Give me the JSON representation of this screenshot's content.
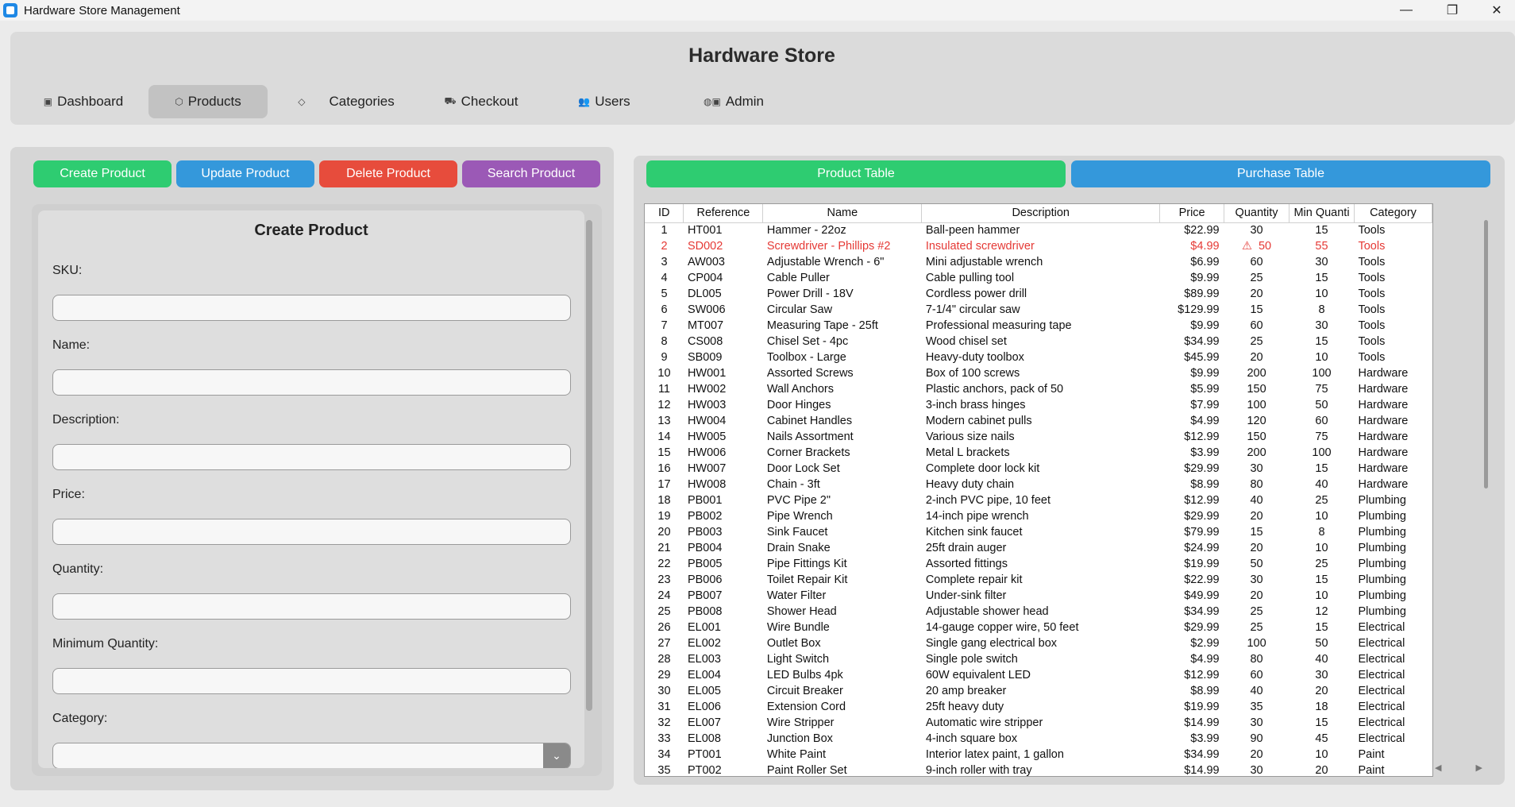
{
  "window": {
    "title": "Hardware Store Management",
    "minimize": "—",
    "maximize": "❐",
    "close": "✕"
  },
  "header": {
    "title": "Hardware Store",
    "tabs": [
      {
        "icon": "▣",
        "label": "Dashboard"
      },
      {
        "icon": "⬡",
        "label": "Products"
      },
      {
        "icon": "◇",
        "label": "Categories"
      },
      {
        "icon": "⛟",
        "label": "Checkout"
      },
      {
        "icon": "👥",
        "label": "Users"
      },
      {
        "icon": "◍▣",
        "label": "Admin"
      }
    ],
    "active_tab": "Products"
  },
  "actions": {
    "create": "Create Product",
    "update": "Update Product",
    "delete": "Delete Product",
    "search": "Search Product"
  },
  "form": {
    "title": "Create Product",
    "sku_label": "SKU:",
    "name_label": "Name:",
    "description_label": "Description:",
    "price_label": "Price:",
    "quantity_label": "Quantity:",
    "min_quantity_label": "Minimum Quantity:",
    "category_label": "Category:",
    "sku_value": "",
    "name_value": "",
    "description_value": "",
    "price_value": "",
    "quantity_value": "",
    "min_quantity_value": "",
    "category_value": "",
    "dropdown_glyph": "⌄"
  },
  "table_tabs": {
    "product": "Product Table",
    "purchase": "Purchase Table"
  },
  "colors": {
    "green": "#2ecc71",
    "blue": "#3498db",
    "red": "#e74c3c",
    "purple": "#9b59b6",
    "alert": "#e53935"
  },
  "table": {
    "columns": [
      "ID",
      "Reference",
      "Name",
      "Description",
      "Price",
      "Quantity",
      "Min Quanti",
      "Category"
    ],
    "alert_glyph": "⚠",
    "rows": [
      [
        "1",
        "HT001",
        "Hammer - 22oz",
        "Ball-peen hammer",
        "$22.99",
        "30",
        "15",
        "Tools"
      ],
      [
        "2",
        "SD002",
        "Screwdriver - Phillips #2",
        "Insulated screwdriver",
        "$4.99",
        "50",
        "55",
        "Tools"
      ],
      [
        "3",
        "AW003",
        "Adjustable Wrench - 6\"",
        "Mini adjustable wrench",
        "$6.99",
        "60",
        "30",
        "Tools"
      ],
      [
        "4",
        "CP004",
        "Cable Puller",
        "Cable pulling tool",
        "$9.99",
        "25",
        "15",
        "Tools"
      ],
      [
        "5",
        "DL005",
        "Power Drill - 18V",
        "Cordless power drill",
        "$89.99",
        "20",
        "10",
        "Tools"
      ],
      [
        "6",
        "SW006",
        "Circular Saw",
        "7-1/4\" circular saw",
        "$129.99",
        "15",
        "8",
        "Tools"
      ],
      [
        "7",
        "MT007",
        "Measuring Tape - 25ft",
        "Professional measuring tape",
        "$9.99",
        "60",
        "30",
        "Tools"
      ],
      [
        "8",
        "CS008",
        "Chisel Set - 4pc",
        "Wood chisel set",
        "$34.99",
        "25",
        "15",
        "Tools"
      ],
      [
        "9",
        "SB009",
        "Toolbox - Large",
        "Heavy-duty toolbox",
        "$45.99",
        "20",
        "10",
        "Tools"
      ],
      [
        "10",
        "HW001",
        "Assorted Screws",
        "Box of 100 screws",
        "$9.99",
        "200",
        "100",
        "Hardware"
      ],
      [
        "11",
        "HW002",
        "Wall Anchors",
        "Plastic anchors, pack of 50",
        "$5.99",
        "150",
        "75",
        "Hardware"
      ],
      [
        "12",
        "HW003",
        "Door Hinges",
        "3-inch brass hinges",
        "$7.99",
        "100",
        "50",
        "Hardware"
      ],
      [
        "13",
        "HW004",
        "Cabinet Handles",
        "Modern cabinet pulls",
        "$4.99",
        "120",
        "60",
        "Hardware"
      ],
      [
        "14",
        "HW005",
        "Nails Assortment",
        "Various size nails",
        "$12.99",
        "150",
        "75",
        "Hardware"
      ],
      [
        "15",
        "HW006",
        "Corner Brackets",
        "Metal L brackets",
        "$3.99",
        "200",
        "100",
        "Hardware"
      ],
      [
        "16",
        "HW007",
        "Door Lock Set",
        "Complete door lock kit",
        "$29.99",
        "30",
        "15",
        "Hardware"
      ],
      [
        "17",
        "HW008",
        "Chain - 3ft",
        "Heavy duty chain",
        "$8.99",
        "80",
        "40",
        "Hardware"
      ],
      [
        "18",
        "PB001",
        "PVC Pipe 2\"",
        "2-inch PVC pipe, 10 feet",
        "$12.99",
        "40",
        "25",
        "Plumbing"
      ],
      [
        "19",
        "PB002",
        "Pipe Wrench",
        "14-inch pipe wrench",
        "$29.99",
        "20",
        "10",
        "Plumbing"
      ],
      [
        "20",
        "PB003",
        "Sink Faucet",
        "Kitchen sink faucet",
        "$79.99",
        "15",
        "8",
        "Plumbing"
      ],
      [
        "21",
        "PB004",
        "Drain Snake",
        "25ft drain auger",
        "$24.99",
        "20",
        "10",
        "Plumbing"
      ],
      [
        "22",
        "PB005",
        "Pipe Fittings Kit",
        "Assorted fittings",
        "$19.99",
        "50",
        "25",
        "Plumbing"
      ],
      [
        "23",
        "PB006",
        "Toilet Repair Kit",
        "Complete repair kit",
        "$22.99",
        "30",
        "15",
        "Plumbing"
      ],
      [
        "24",
        "PB007",
        "Water Filter",
        "Under-sink filter",
        "$49.99",
        "20",
        "10",
        "Plumbing"
      ],
      [
        "25",
        "PB008",
        "Shower Head",
        "Adjustable shower head",
        "$34.99",
        "25",
        "12",
        "Plumbing"
      ],
      [
        "26",
        "EL001",
        "Wire Bundle",
        "14-gauge copper wire, 50 feet",
        "$29.99",
        "25",
        "15",
        "Electrical"
      ],
      [
        "27",
        "EL002",
        "Outlet Box",
        "Single gang electrical box",
        "$2.99",
        "100",
        "50",
        "Electrical"
      ],
      [
        "28",
        "EL003",
        "Light Switch",
        "Single pole switch",
        "$4.99",
        "80",
        "40",
        "Electrical"
      ],
      [
        "29",
        "EL004",
        "LED Bulbs 4pk",
        "60W equivalent LED",
        "$12.99",
        "60",
        "30",
        "Electrical"
      ],
      [
        "30",
        "EL005",
        "Circuit Breaker",
        "20 amp breaker",
        "$8.99",
        "40",
        "20",
        "Electrical"
      ],
      [
        "31",
        "EL006",
        "Extension Cord",
        "25ft heavy duty",
        "$19.99",
        "35",
        "18",
        "Electrical"
      ],
      [
        "32",
        "EL007",
        "Wire Stripper",
        "Automatic wire stripper",
        "$14.99",
        "30",
        "15",
        "Electrical"
      ],
      [
        "33",
        "EL008",
        "Junction Box",
        "4-inch square box",
        "$3.99",
        "90",
        "45",
        "Electrical"
      ],
      [
        "34",
        "PT001",
        "White Paint",
        "Interior latex paint, 1 gallon",
        "$34.99",
        "20",
        "10",
        "Paint"
      ],
      [
        "35",
        "PT002",
        "Paint Roller Set",
        "9-inch roller with tray",
        "$14.99",
        "30",
        "20",
        "Paint"
      ]
    ]
  }
}
